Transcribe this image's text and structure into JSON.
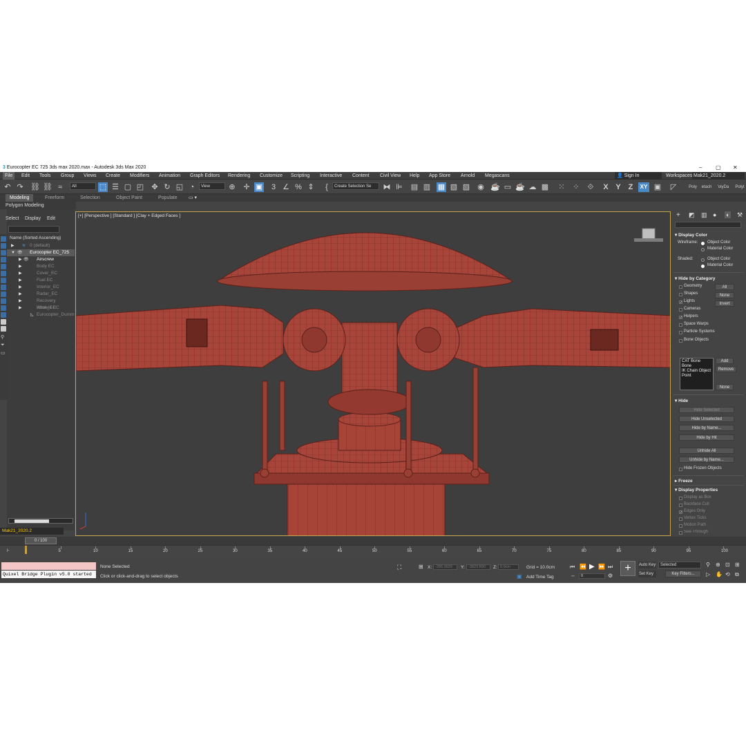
{
  "window": {
    "title": "Eurocopter EC 725 3ds max 2020.max - Autodesk 3ds Max 2020",
    "minimize": "–",
    "maximize": "▢",
    "close": "✕"
  },
  "menu": [
    "File",
    "Edit",
    "Tools",
    "Group",
    "Views",
    "Create",
    "Modifiers",
    "Animation",
    "Graph Editors",
    "Rendering",
    "Customize",
    "Scripting",
    "Interactive",
    "Content",
    "Civil View",
    "Help",
    "App Store",
    "Arnold",
    "Megascans"
  ],
  "account": {
    "sign_in": "Sign In",
    "workspaces_label": "Workspaces:",
    "workspace_value": "Mak21_2020.2"
  },
  "toolbar": {
    "filter_value": "All",
    "refcoord_value": "View",
    "named_sel_placeholder": "Create Selection Se",
    "axis_x": "X",
    "axis_y": "Y",
    "axis_z": "Z",
    "axis_xy": "XY",
    "poly": "Poly",
    "etach": "etach",
    "olyda": "'olyDa",
    "polyr": "Polyt"
  },
  "ribbon": {
    "tabs": [
      "Modeling",
      "Freeform",
      "Selection",
      "Object Paint",
      "Populate"
    ],
    "sub": "Polygon Modeling"
  },
  "scene_explorer": {
    "tabs": [
      "Select",
      "Display",
      "Edit"
    ],
    "column_header": "Name (Sorted Ascending)",
    "rows": [
      {
        "label": "0 (default)",
        "dim": true
      },
      {
        "label": "Eurocopter EC_725",
        "dim": false,
        "highlight": true
      },
      {
        "label": "Airscrew",
        "dim": false
      },
      {
        "label": "Body EC",
        "dim": true
      },
      {
        "label": "Cover_EC",
        "dim": true
      },
      {
        "label": "Fuel EC",
        "dim": true
      },
      {
        "label": "Interior_EC",
        "dim": true
      },
      {
        "label": "Radar_EC",
        "dim": true
      },
      {
        "label": "Recovery Hook_EC",
        "dim": true
      },
      {
        "label": "Wheels EC",
        "dim": true
      },
      {
        "label": "Eurocopter_Dumm",
        "dim": true
      }
    ],
    "layer": "Mak21_2020.2"
  },
  "viewport": {
    "label": "[+] [Perspective ] [Standard ] [Clay + Edged Faces ]",
    "model_color": "#a8453a",
    "bg_color": "#3e3e3e"
  },
  "command_panel": {
    "display_color": {
      "title": "Display Color",
      "wireframe_label": "Wireframe:",
      "shaded_label": "Shaded:",
      "object_color": "Object Color",
      "material_color": "Material Color"
    },
    "hide_by_category": {
      "title": "Hide by Category",
      "items": [
        {
          "label": "Geometry",
          "checked": false
        },
        {
          "label": "Shapes",
          "checked": false
        },
        {
          "label": "Lights",
          "checked": true
        },
        {
          "label": "Cameras",
          "checked": false
        },
        {
          "label": "Helpers",
          "checked": true
        },
        {
          "label": "Space Warps",
          "checked": false
        },
        {
          "label": "Particle Systems",
          "checked": false
        },
        {
          "label": "Bone Objects",
          "checked": false
        }
      ],
      "all": "All",
      "none": "None",
      "invert": "Invert",
      "list": [
        "CAT Bone",
        "Bone",
        "IK Chain Object",
        "Point"
      ],
      "add": "Add",
      "remove": "Remove",
      "none2": "None"
    },
    "hide": {
      "title": "Hide",
      "buttons": [
        "Hide Selected",
        "Hide Unselected",
        "Hide by Name...",
        "Hide by Hit",
        "Unhide All",
        "Unhide by Name..."
      ],
      "hide_frozen": "Hide Frozen Objects"
    },
    "freeze_title": "Freeze",
    "display_properties": {
      "title": "Display Properties",
      "items": [
        "Display as Box",
        "Backface Cull",
        "Edges Only",
        "Vertex Ticks",
        "Motion Path",
        "See-Through"
      ]
    }
  },
  "timeline": {
    "slider": "0 / 100",
    "ticks": [
      "0",
      "5",
      "10",
      "15",
      "20",
      "25",
      "30",
      "35",
      "40",
      "45",
      "50",
      "55",
      "60",
      "65",
      "70",
      "75",
      "80",
      "85",
      "90",
      "95",
      "100"
    ]
  },
  "status": {
    "quixel": "Quixel Bridge Plugin v5.0 started",
    "selection": "None Selected",
    "prompt": "Click or click-and-drag to select objects",
    "x_label": "X:",
    "x_value": "-286.3629",
    "y_label": "Y:",
    "y_value": "-3823.890",
    "z_label": "Z:",
    "z_value": "0.0cm",
    "grid": "Grid = 10.0cm",
    "add_time_tag": "Add Time Tag",
    "frame": "0",
    "auto_key": "Auto Key",
    "set_key": "Set Key",
    "key_mode": "Selected",
    "key_filters": "Key Filters..."
  }
}
